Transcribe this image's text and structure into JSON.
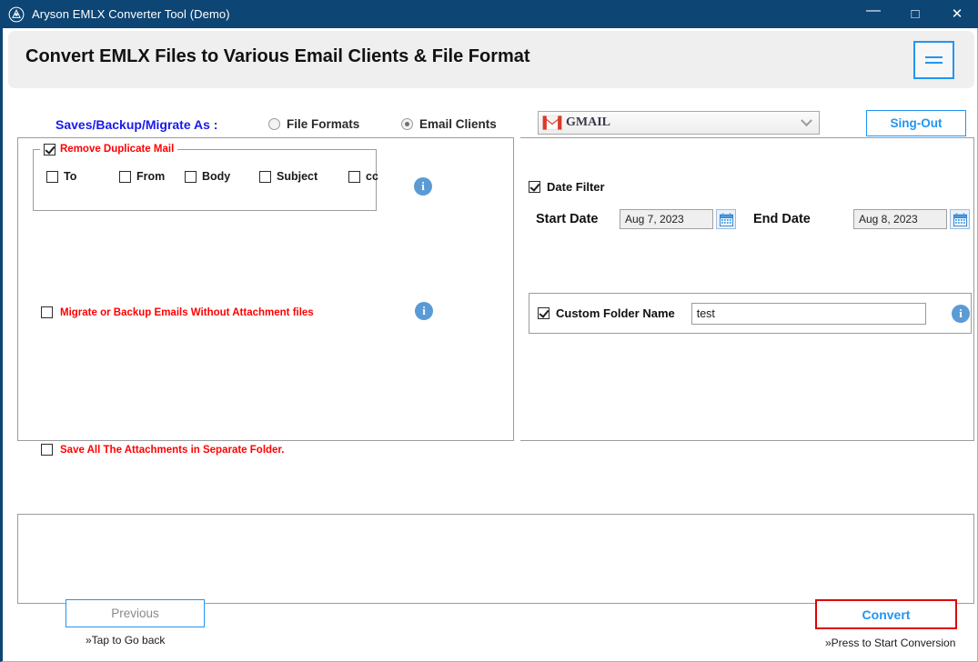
{
  "window": {
    "title": "Aryson EMLX Converter Tool (Demo)",
    "logo_icon": "aryson-logo-icon",
    "controls": {
      "minimize": "—",
      "maximize": "□",
      "close": "✕"
    },
    "titlebar_color": "#0d4574"
  },
  "header": {
    "title": "Convert EMLX Files to Various Email Clients & File Format",
    "menu_icon": "hamburger-menu-icon",
    "accent_color": "#2196f3"
  },
  "options": {
    "saves_label": "Saves/Backup/Migrate As :",
    "saves_label_color": "#1a1aee",
    "radios": [
      {
        "label": "File Formats",
        "selected": false
      },
      {
        "label": "Email Clients",
        "selected": true
      }
    ],
    "client_combo": {
      "value": "GMAIL",
      "icon": "gmail-logo-icon",
      "arrow_icon": "chevron-down-icon"
    },
    "signout_label": "Sing-Out"
  },
  "left_panel": {
    "duplicate_group": {
      "legend": "Remove Duplicate Mail",
      "legend_color": "#ff0000",
      "checked": true,
      "fields": [
        {
          "label": "To",
          "checked": false
        },
        {
          "label": "From",
          "checked": false
        },
        {
          "label": "Body",
          "checked": false
        },
        {
          "label": "Subject",
          "checked": false
        },
        {
          "label": "cc",
          "checked": false
        }
      ],
      "info_icon": "info-icon"
    },
    "no_attachment": {
      "label": "Migrate or Backup Emails Without Attachment files",
      "checked": false,
      "info_icon": "info-icon"
    },
    "separate_folder": {
      "label": "Save All The Attachments in Separate Folder.",
      "checked": false
    }
  },
  "right_panel": {
    "date_filter": {
      "label": "Date Filter",
      "checked": true,
      "start_label": "Start Date",
      "start_value": "Aug 7, 2023",
      "end_label": "End Date",
      "end_value": "Aug 8, 2023",
      "calendar_icon": "calendar-icon"
    },
    "custom_folder": {
      "label": "Custom Folder Name",
      "checked": true,
      "value": "test",
      "placeholder": "",
      "info_icon": "info-icon"
    }
  },
  "footer": {
    "previous_label": "Previous",
    "previous_caption": "»Tap to Go back",
    "convert_label": "Convert",
    "convert_caption": "»Press to Start Conversion",
    "convert_border_color": "#e00000",
    "convert_text_color": "#2196f3"
  }
}
